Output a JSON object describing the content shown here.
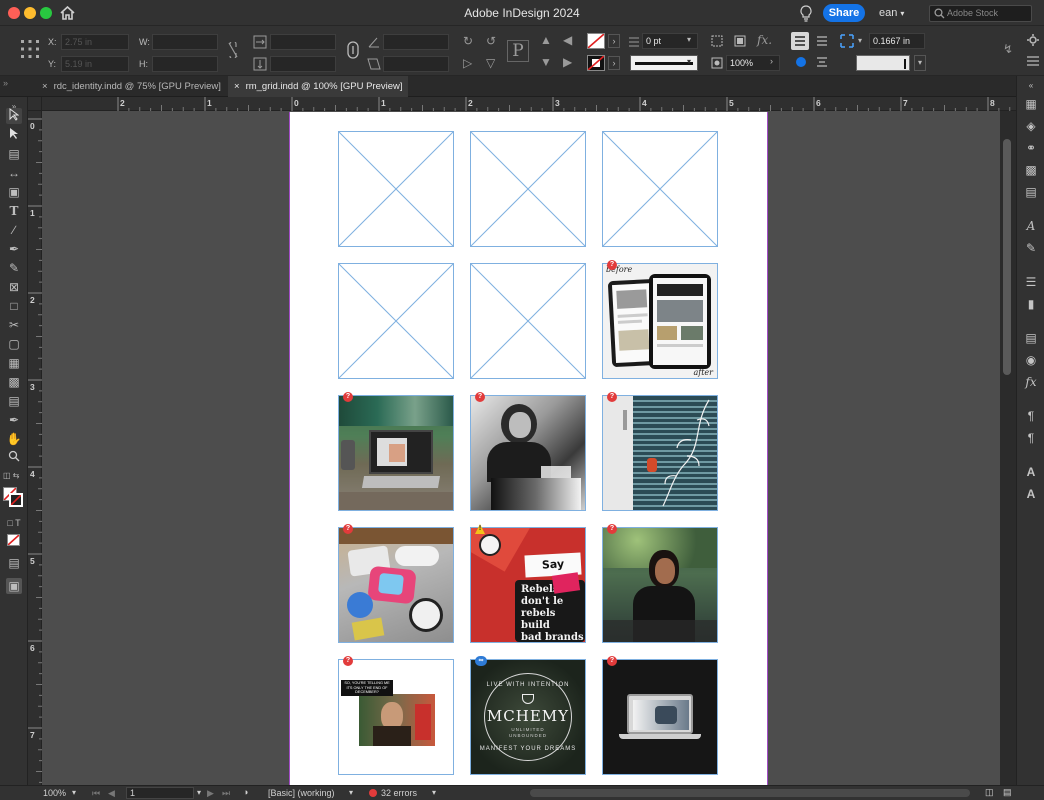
{
  "window": {
    "title": "Adobe InDesign 2024",
    "share_label": "Share",
    "user": "ean",
    "stock_placeholder": "Adobe Stock"
  },
  "control": {
    "x_label": "X:",
    "x_value": "2.75 in",
    "y_label": "Y:",
    "y_value": "5.19 in",
    "w_label": "W:",
    "h_label": "H:",
    "stroke_weight": "0 pt",
    "opacity": "100%",
    "spacing": "0.1667 in"
  },
  "tabs": [
    {
      "label": "rdc_identity.indd @ 75% [GPU Preview]",
      "active": false
    },
    {
      "label": "rm_grid.indd @ 100% [GPU Preview]",
      "active": true
    }
  ],
  "ruler": {
    "top": [
      "2",
      "1",
      "0",
      "1",
      "2",
      "3",
      "4",
      "5",
      "6",
      "7",
      "8"
    ],
    "left": [
      "0",
      "1",
      "2",
      "3",
      "4",
      "5",
      "6",
      "7"
    ]
  },
  "grid": {
    "frames": [
      {
        "kind": "empty"
      },
      {
        "kind": "empty"
      },
      {
        "kind": "empty"
      },
      {
        "kind": "empty"
      },
      {
        "kind": "empty"
      },
      {
        "kind": "image",
        "art": "tablets",
        "badge": "error"
      },
      {
        "kind": "image",
        "art": "desk-laptop",
        "badge": "error"
      },
      {
        "kind": "image",
        "art": "bw-woman",
        "badge": "error"
      },
      {
        "kind": "image",
        "art": "window-blinds",
        "badge": "error"
      },
      {
        "kind": "image",
        "art": "stickers-laptop",
        "badge": "error"
      },
      {
        "kind": "image",
        "art": "say-cheers",
        "badge": "warning"
      },
      {
        "kind": "image",
        "art": "woman-jacket",
        "badge": "error"
      },
      {
        "kind": "image",
        "art": "meme",
        "badge": "error"
      },
      {
        "kind": "image",
        "art": "mchemy",
        "badge": "link"
      },
      {
        "kind": "image",
        "art": "dark-laptop",
        "badge": "error"
      }
    ],
    "texts": {
      "before": "before",
      "after": "after",
      "say_cheers": "Say Cheers",
      "rebels1": "Rebels",
      "rebels2": "don't le",
      "rebels3": "rebels build",
      "rebels4": "bad brands",
      "mchemy": "MCHEMY",
      "mchemy_top": "LIVE WITH INTENTION",
      "mchemy_sub1": "UNLIMITED",
      "mchemy_sub2": "UNBOUNDED",
      "mchemy_bottom": "MANIFEST YOUR DREAMS",
      "meme_caption": "SO, YOU'RE TELLING ME ITS ONLY THE END OF DECEMBER?"
    }
  },
  "status": {
    "zoom": "100%",
    "page": "1",
    "style": "[Basic] (working)",
    "errors": "32 errors"
  },
  "colors": {
    "accent": "#1473e6",
    "frame_stroke": "#7fb0e0",
    "page_border": "#a24cc6",
    "error": "#e23b3b",
    "warning": "#f4c21a"
  }
}
